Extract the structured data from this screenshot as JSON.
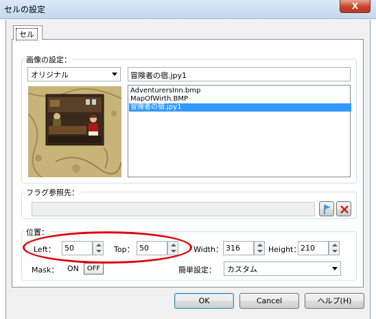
{
  "window": {
    "title": "セルの設定",
    "close_label": "X"
  },
  "tab": {
    "label": "セル"
  },
  "image_settings": {
    "group_label": "画像の設定：",
    "source_select": "オリジナル",
    "filename": "冒険者の宿.jpy1",
    "files": [
      "AdventurersInn.bmp",
      "MapOfWirth.BMP",
      "冒険者の宿.jpy1"
    ],
    "selected_index": 2
  },
  "flag": {
    "group_label": "フラグ参照先：",
    "value": ""
  },
  "position": {
    "group_label": "位置：",
    "left_label": "Left：",
    "left_value": "50",
    "top_label": "Top：",
    "top_value": "50",
    "width_label": "Width：",
    "width_value": "316",
    "height_label": "Height：",
    "height_value": "210",
    "mask_label": "Mask：",
    "mask_on_label": "ON",
    "mask_off_label": "OFF",
    "simple_label": "簡単設定：",
    "simple_value": "カスタム"
  },
  "buttons": {
    "ok": "OK",
    "cancel": "Cancel",
    "help": "ヘルプ(H)"
  },
  "colors": {
    "selection": "#3399ff",
    "annotation": "#e0000c",
    "flag_icon": "#2a7fc0",
    "clear_icon": "#d02020"
  }
}
